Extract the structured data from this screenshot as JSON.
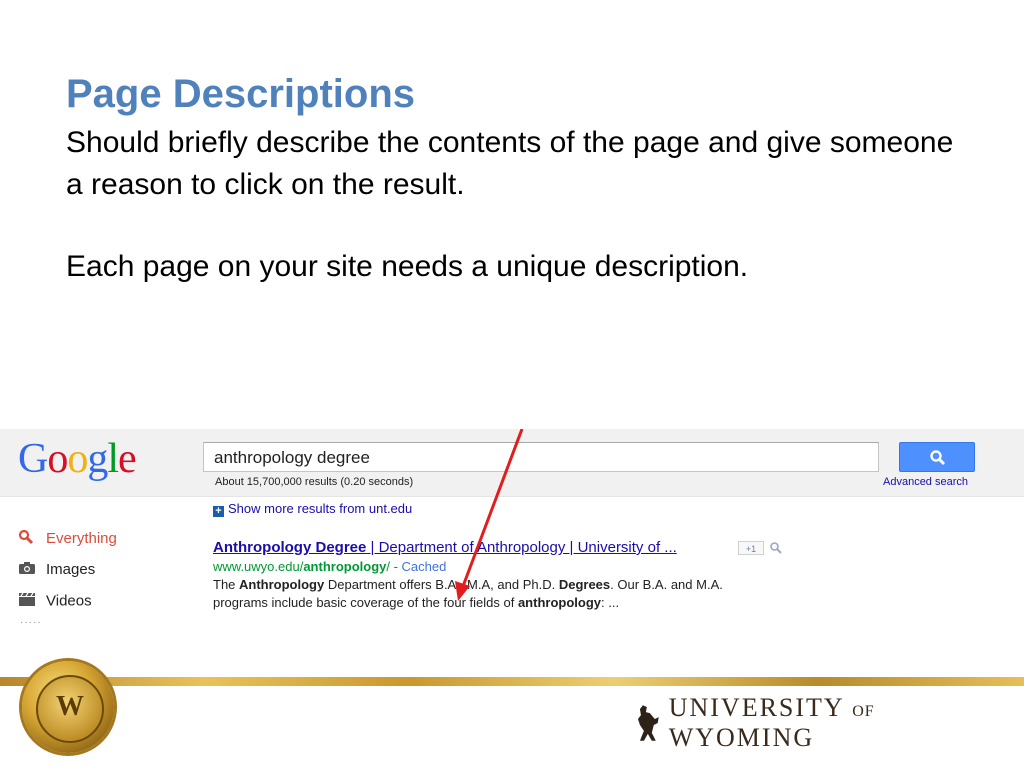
{
  "slide": {
    "title": "Page Descriptions",
    "body_line1": "Should briefly describe the contents of the page and give someone a reason to click on the result.",
    "body_line2": "Each page on your site needs a unique description."
  },
  "google": {
    "logo_letters": [
      "G",
      "o",
      "o",
      "g",
      "l",
      "e"
    ],
    "logo_colors": [
      "#3369e8",
      "#d50f25",
      "#eeb211",
      "#3369e8",
      "#009925",
      "#d50f25"
    ],
    "search_value": "anthropology degree",
    "search_icon": "magnifier-icon",
    "result_stats": "About 15,700,000 results (0.20 seconds)",
    "advanced_search": "Advanced search",
    "show_more": "Show more results from unt.edu",
    "sidebar": [
      {
        "label": "Everything",
        "icon": "search-icon",
        "active": true
      },
      {
        "label": "Images",
        "icon": "camera-icon",
        "active": false
      },
      {
        "label": "Videos",
        "icon": "film-icon",
        "active": false
      }
    ],
    "sidebar_more": "·····",
    "result": {
      "title_bold": "Anthropology Degree",
      "title_rest": " | Department of Anthropology | University of ...",
      "plus_one": "+1",
      "url_prefix": "www.uwyo.edu/",
      "url_bold": "anthropology",
      "url_suffix": "/ - ",
      "cached": "Cached",
      "snippet_parts": [
        {
          "t": "The ",
          "b": false
        },
        {
          "t": "Anthropology",
          "b": true
        },
        {
          "t": " Department offers B.A., M.A, and Ph.D. ",
          "b": false
        },
        {
          "t": "Degrees",
          "b": true
        },
        {
          "t": ". Our B.A. and M.A. programs include basic coverage of the four fields of ",
          "b": false
        },
        {
          "t": "anthropology",
          "b": true
        },
        {
          "t": ": ...",
          "b": false
        }
      ]
    }
  },
  "footer": {
    "seal_text": "W",
    "logo_main": "UNIVERSITY",
    "logo_of": "OF",
    "logo_end": "WYOMING",
    "accent": "#e9c25a"
  }
}
